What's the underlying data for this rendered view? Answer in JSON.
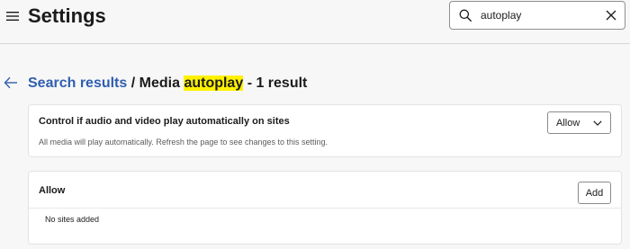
{
  "header": {
    "title": "Settings",
    "search": {
      "value": "autoplay",
      "placeholder": "Search settings"
    }
  },
  "breadcrumb": {
    "link": "Search results",
    "separator": "/",
    "prefix": "Media",
    "highlight": "autoplay",
    "suffix": "- 1 result"
  },
  "autoplay_setting": {
    "title": "Control if audio and video play automatically on sites",
    "description": "All media will play automatically. Refresh the page to see changes to this setting.",
    "selected_option": "Allow"
  },
  "allow_list": {
    "title": "Allow",
    "add_label": "Add",
    "empty_text": "No sites added"
  },
  "icons": {
    "menu": "hamburger-menu-icon",
    "search": "search-icon",
    "clear": "close-icon",
    "back": "back-arrow-icon",
    "dropdown": "chevron-down-icon"
  },
  "colors": {
    "link": "#2f5eaf",
    "highlight": "#fff100",
    "background": "#f7f7f7",
    "card": "#ffffff"
  }
}
